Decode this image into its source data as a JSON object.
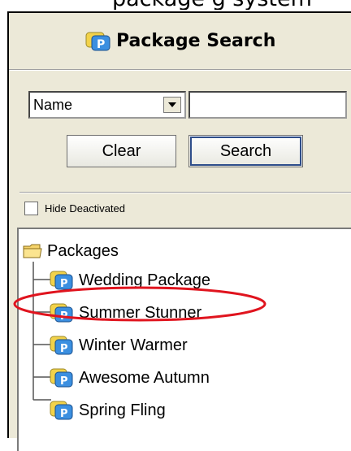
{
  "top_text": "package g system",
  "header": {
    "title": "Package Search",
    "logo_letter": "P"
  },
  "search": {
    "field_value": "Name",
    "input_value": "",
    "clear_label": "Clear",
    "search_label": "Search"
  },
  "filter": {
    "hide_deactivated_label": "Hide Deactivated",
    "checked": false
  },
  "tree": {
    "root_label": "Packages",
    "items": [
      {
        "label": "Wedding Package"
      },
      {
        "label": "Summer Stunner"
      },
      {
        "label": "Winter Warmer"
      },
      {
        "label": "Awesome Autumn"
      },
      {
        "label": "Spring Fling"
      }
    ],
    "icon_letter": "P"
  },
  "colors": {
    "panel": "#ece9d8",
    "highlight": "#e0141e",
    "icon_yellow": "#f2d24a",
    "icon_blue": "#3b8fe0"
  }
}
